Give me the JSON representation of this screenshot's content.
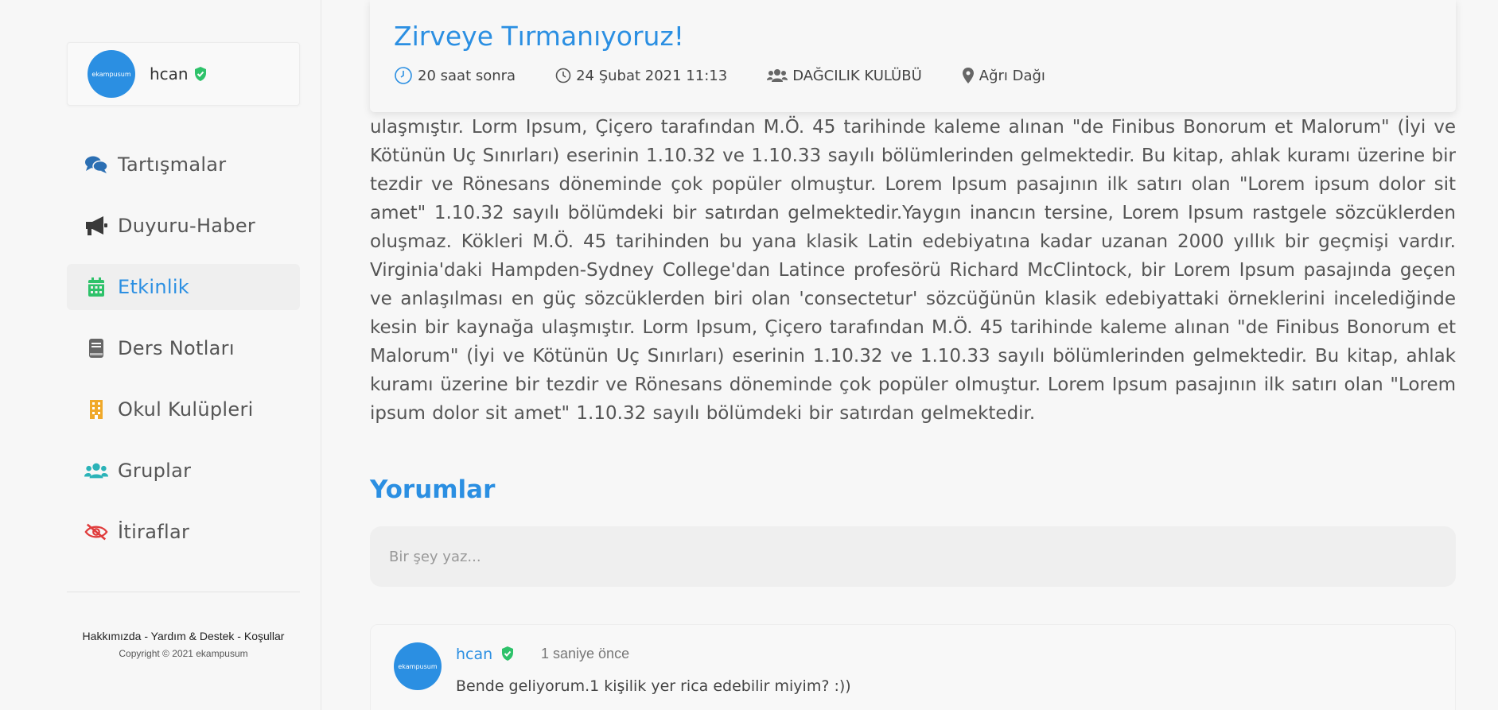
{
  "user": {
    "name": "hcan",
    "avatar_text": "ekampusum"
  },
  "sidebar": {
    "items": [
      {
        "label": "Tartışmalar",
        "icon": "comments-icon",
        "color": "#2b6fb3"
      },
      {
        "label": "Duyuru-Haber",
        "icon": "megaphone-icon",
        "color": "#3a3a3a"
      },
      {
        "label": "Etkinlik",
        "icon": "calendar-icon",
        "color": "#2ec26a",
        "active": true
      },
      {
        "label": "Ders Notları",
        "icon": "book-icon",
        "color": "#666666"
      },
      {
        "label": "Okul Kulüpleri",
        "icon": "building-icon",
        "color": "#f0a92a"
      },
      {
        "label": "Gruplar",
        "icon": "users-icon",
        "color": "#2bb3b8"
      },
      {
        "label": "İtiraflar",
        "icon": "eye-slash-icon",
        "color": "#e03c3c"
      }
    ],
    "footer_links": "Hakkımızda - Yardım & Destek - Koşullar",
    "copyright": "Copyright © 2021 ekampusum"
  },
  "event": {
    "title": "Zirveye Tırmanıyoruz!",
    "relative_time": "20 saat sonra",
    "datetime": "24 Şubat 2021 11:13",
    "club": "DAĞCILIK KULÜBÜ",
    "location": "Ağrı Dağı",
    "description": "ulaşmıştır. Lorm Ipsum, Çiçero tarafından M.Ö. 45 tarihinde kaleme alınan \"de Finibus Bonorum et Malorum\" (İyi ve Kötünün Uç Sınırları) eserinin 1.10.32 ve 1.10.33 sayılı bölümlerinden gelmektedir. Bu kitap, ahlak kuramı üzerine bir tezdir ve Rönesans döneminde çok popüler olmuştur. Lorem Ipsum pasajının ilk satırı olan \"Lorem ipsum dolor sit amet\" 1.10.32 sayılı bölümdeki bir satırdan gelmektedir.Yaygın inancın tersine, Lorem Ipsum rastgele sözcüklerden oluşmaz. Kökleri M.Ö. 45 tarihinden bu yana klasik Latin edebiyatına kadar uzanan 2000 yıllık bir geçmişi vardır. Virginia'daki Hampden-Sydney College'dan Latince profesörü Richard McClintock, bir Lorem Ipsum pasajında geçen ve anlaşılması en güç sözcüklerden biri olan 'consectetur' sözcüğünün klasik edebiyattaki örneklerini incelediğinde kesin bir kaynağa ulaşmıştır. Lorm Ipsum, Çiçero tarafından M.Ö. 45 tarihinde kaleme alınan \"de Finibus Bonorum et Malorum\" (İyi ve Kötünün Uç Sınırları) eserinin 1.10.32 ve 1.10.33 sayılı bölümlerinden gelmektedir. Bu kitap, ahlak kuramı üzerine bir tezdir ve Rönesans döneminde çok popüler olmuştur. Lorem Ipsum pasajının ilk satırı olan \"Lorem ipsum dolor sit amet\" 1.10.32 sayılı bölümdeki bir satırdan gelmektedir."
  },
  "comments": {
    "title": "Yorumlar",
    "input_placeholder": "Bir şey yaz...",
    "items": [
      {
        "author": "hcan",
        "time": "1 saniye önce",
        "text": "Bende geliyorum.1 kişilik yer rica edebilir miyim? :))"
      }
    ]
  },
  "colors": {
    "accent": "#2b8fe2",
    "verified": "#2ec26a"
  }
}
